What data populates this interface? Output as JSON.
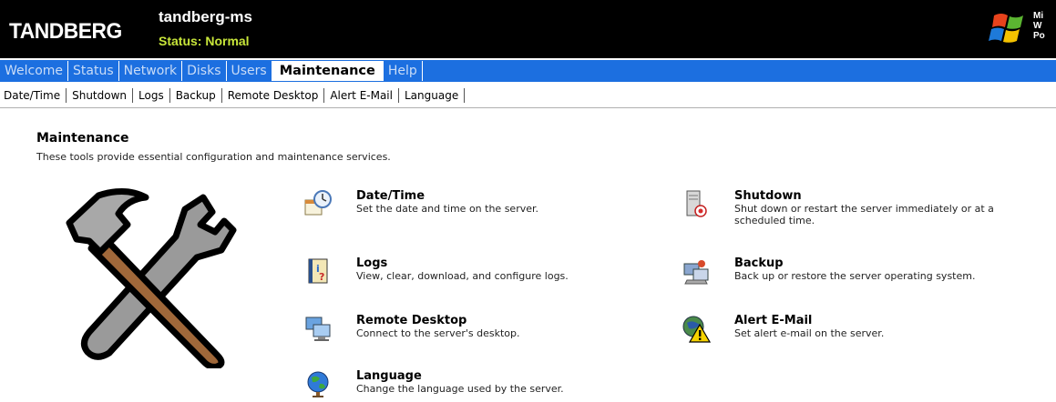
{
  "header": {
    "brand": "TANDBERG",
    "server_name": "tandberg-ms",
    "status": "Status: Normal",
    "windows_text": [
      "Mi",
      "W",
      "Po"
    ]
  },
  "nav": {
    "items": [
      "Welcome",
      "Status",
      "Network",
      "Disks",
      "Users",
      "Maintenance",
      "Help"
    ],
    "active": "Maintenance"
  },
  "subnav": {
    "items": [
      "Date/Time",
      "Shutdown",
      "Logs",
      "Backup",
      "Remote Desktop",
      "Alert E-Mail",
      "Language"
    ]
  },
  "page": {
    "title": "Maintenance",
    "description": "These tools provide essential configuration and maintenance services."
  },
  "tools": [
    {
      "title": "Date/Time",
      "desc": "Set the date and time on the server.",
      "icon": "clock-calendar-icon"
    },
    {
      "title": "Shutdown",
      "desc": "Shut down or restart the server immediately or at a scheduled time.",
      "icon": "server-power-icon"
    },
    {
      "title": "Logs",
      "desc": "View, clear, download, and configure logs.",
      "icon": "log-book-icon"
    },
    {
      "title": "Backup",
      "desc": "Back up or restore the server operating system.",
      "icon": "backup-icon"
    },
    {
      "title": "Remote Desktop",
      "desc": "Connect to the server's desktop.",
      "icon": "remote-desktop-icon"
    },
    {
      "title": "Alert E-Mail",
      "desc": "Set alert e-mail on the server.",
      "icon": "alert-email-icon"
    },
    {
      "title": "Language",
      "desc": "Change the language used by the server.",
      "icon": "globe-icon"
    }
  ],
  "colors": {
    "nav_bar": "#1c6fe0",
    "status_green": "#c8e63a",
    "header_bg": "#000000"
  }
}
